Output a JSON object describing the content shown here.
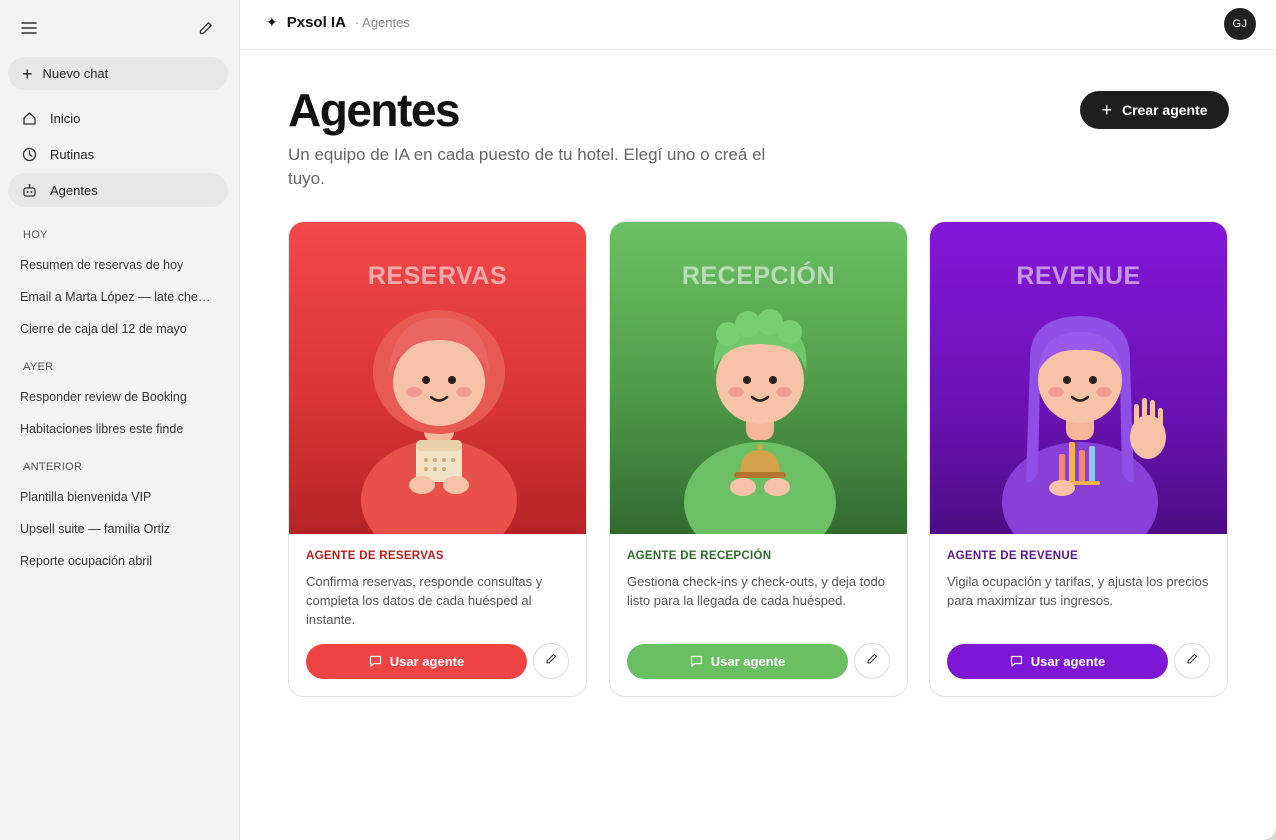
{
  "sidebar": {
    "new_chat": "Nuevo chat",
    "nav": [
      {
        "label": "Inicio",
        "icon": "home-icon"
      },
      {
        "label": "Rutinas",
        "icon": "clock-icon"
      },
      {
        "label": "Agentes",
        "icon": "robot-icon",
        "active": true
      }
    ],
    "sections": [
      {
        "label": "HOY",
        "items": [
          "Resumen de reservas de hoy",
          "Email a Marta López — late check-out",
          "Cierre de caja del 12 de mayo"
        ]
      },
      {
        "label": "AYER",
        "items": [
          "Responder review de Booking",
          "Habitaciones libres este finde"
        ]
      },
      {
        "label": "ANTERIOR",
        "items": [
          "Plantilla bienvenida VIP",
          "Upsell suite — familia Ortiz",
          "Reporte ocupación abril"
        ]
      }
    ]
  },
  "topbar": {
    "brand": "Pxsol IA",
    "crumb": "· Agentes",
    "avatar": "GJ"
  },
  "page": {
    "title": "Agentes",
    "subtitle": "Un equipo de IA en cada puesto de tu hotel. Elegí uno o creá el tuyo.",
    "create_label": "Crear agente"
  },
  "agents": [
    {
      "hero": "RESERVAS",
      "label": "AGENTE DE RESERVAS",
      "desc": "Confirma reservas, responde consultas y completa los datos de cada huésped al instante.",
      "cta": "Usar agente",
      "color": "#ef4444",
      "label_color": "#b91c1c",
      "prop": "calendar-icon"
    },
    {
      "hero": "RECEPCIÓN",
      "label": "AGENTE DE RECEPCIÓN",
      "desc": "Gestiona check-ins y check-outs, y deja todo listo para la llegada de cada huésped.",
      "cta": "Usar agente",
      "color": "#6abf63",
      "label_color": "#2f6b2b",
      "prop": "service-bell-icon"
    },
    {
      "hero": "REVENUE",
      "label": "AGENTE DE REVENUE",
      "desc": "Vigila ocupación y tarifas, y ajusta los precios para maximizar tus ingresos.",
      "cta": "Usar agente",
      "color": "#7e16d6",
      "label_color": "#5b1291",
      "prop": "bar-chart-icon"
    }
  ]
}
